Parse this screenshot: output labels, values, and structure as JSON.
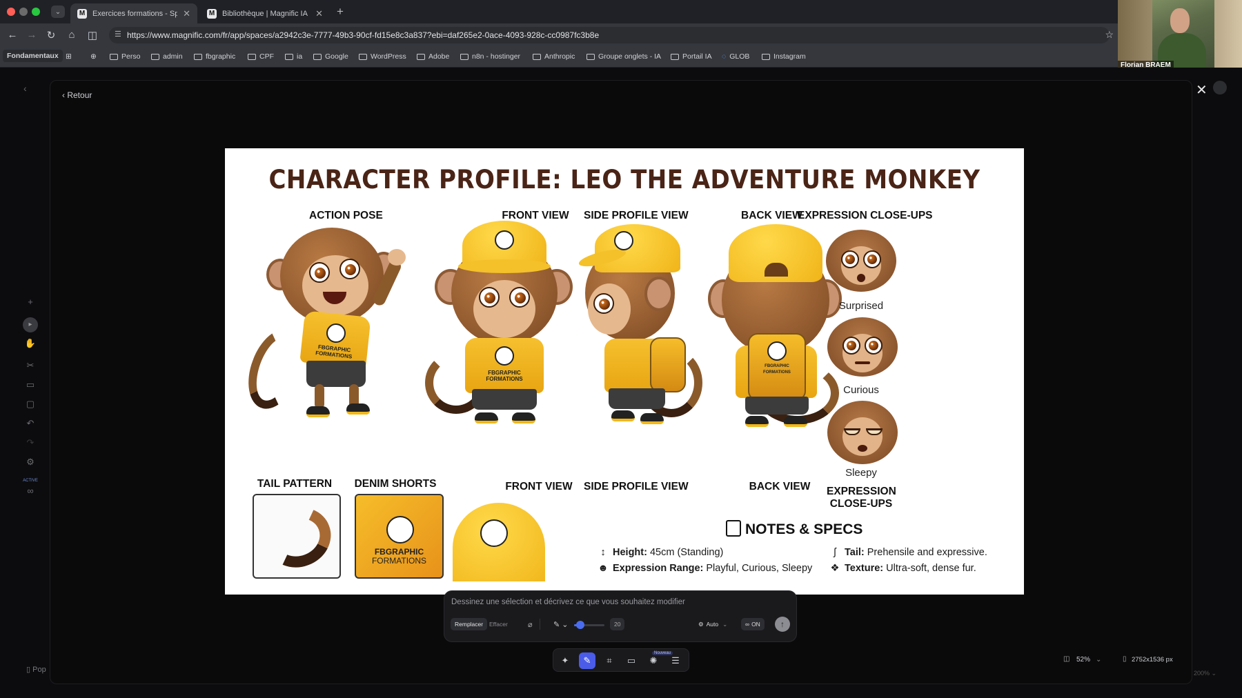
{
  "browser": {
    "tabs": [
      {
        "title": "Exercices formations - Space",
        "active": true
      },
      {
        "title": "Bibliothèque | Magnific IA",
        "active": false
      }
    ],
    "url": "https://www.magnific.com/fr/app/spaces/a2942c3e-7777-49b3-90cf-fd15e8c3a837?ebi=daf265e2-0ace-4093-928c-cc0987fc3b8e",
    "bookmarks": [
      "Fondamentaux",
      "Perso",
      "admin",
      "fbgraphic",
      "CPF",
      "ia",
      "Google",
      "WordPress",
      "Adobe",
      "n8n - hostinger",
      "Anthropic",
      "Groupe onglets - IA",
      "Portail IA",
      "GLOB",
      "Instagram"
    ]
  },
  "webcam": {
    "name": "Florian BRAEM"
  },
  "app": {
    "back_label": "Retour",
    "left_active_label": "ACTIVE",
    "pop_label": "Pop"
  },
  "sheet": {
    "title": "CHARACTER PROFILE: LEO THE ADVENTURE MONKEY",
    "headers": {
      "action_pose": "ACTION POSE",
      "front_view": "FRONT VIEW",
      "side_profile_view": "SIDE PROFILE VIEW",
      "back_view": "BACK VIEW",
      "expression_closeups": "EXPRESSION CLOSE-UPS"
    },
    "captions": {
      "front_view": "FRONT VIEW",
      "side_profile_view": "SIDE PROFILE VIEW",
      "back_view": "BACK VIEW",
      "expression_closeups_1": "EXPRESSION",
      "expression_closeups_2": "CLOSE-UPS"
    },
    "expressions": [
      "Surprised",
      "Curious",
      "Sleepy"
    ],
    "details": {
      "tail_pattern": "TAIL PATTERN",
      "denim_shorts": "DENIM SHORTS"
    },
    "brand": {
      "line1": "FBGRAPHIC",
      "line2": "FORMATIONS"
    },
    "notes": {
      "title": "NOTES & SPECS",
      "height_label": "Height:",
      "height_value": "45cm (Standing)",
      "range_label": "Expression Range:",
      "range_value": "Playful, Curious, Sleepy",
      "tail_label": "Tail:",
      "tail_value": "Prehensile and expressive.",
      "texture_label": "Texture:",
      "texture_value": "Ultra-soft, dense fur."
    }
  },
  "prompt": {
    "placeholder": "Dessinez une sélection et décrivez ce que vous souhaitez modifier",
    "replace_label": "Remplacer",
    "erase_label": "Effacer",
    "brush_size": "20",
    "brush_level": 0.2,
    "mode_label": "Auto",
    "on_label": "ON"
  },
  "toolbar": {
    "new_badge": "Nouveau"
  },
  "status": {
    "zoom": "52%",
    "dimensions": "2752x1536 px",
    "zoom_secondary": "200%"
  }
}
